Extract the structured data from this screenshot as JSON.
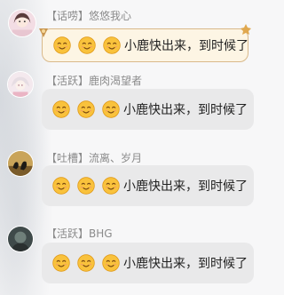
{
  "messages": [
    {
      "tag": "【话唠】",
      "name": "悠悠我心",
      "emojis": [
        "smile-emoji",
        "smile-emoji",
        "smile-emoji"
      ],
      "text": "小鹿快出来，到时候了",
      "avatar": "girl-avatar",
      "bubble": "special"
    },
    {
      "tag": "【活跃】",
      "name": "鹿肉渴望者",
      "emojis": [
        "smile-emoji",
        "smile-emoji",
        "smile-emoji"
      ],
      "text": "小鹿快出来，到时候了",
      "avatar": "anime-avatar",
      "bubble": "normal"
    },
    {
      "tag": "【吐槽】",
      "name": "流离、岁月",
      "emojis": [
        "smile-emoji",
        "smile-emoji",
        "smile-emoji"
      ],
      "text": "小鹿快出来，到时候了",
      "avatar": "birds-avatar",
      "bubble": "normal"
    },
    {
      "tag": "【活跃】",
      "name": "BHG",
      "emojis": [
        "smile-emoji",
        "smile-emoji",
        "smile-emoji"
      ],
      "text": "小鹿快出来，到时候了",
      "avatar": "dark-avatar",
      "bubble": "normal"
    }
  ],
  "colors": {
    "bubble": "#e9e9ea",
    "special_bubble": "#fdf5e4",
    "special_border": "#d9b98a",
    "name_text": "#8b8b8b"
  }
}
